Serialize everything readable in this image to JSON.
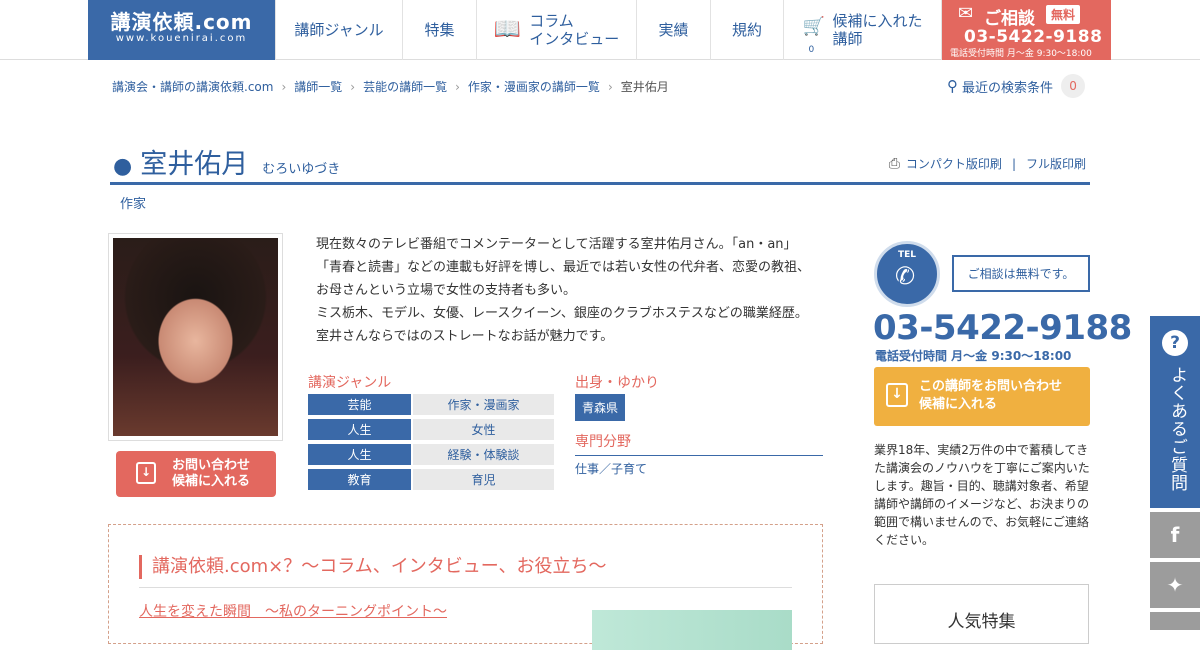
{
  "header": {
    "logo_main": "講演依頼.com",
    "logo_sub": "www.kouenirai.com",
    "nav": [
      {
        "label": "講師ジャンル"
      },
      {
        "label": "特集"
      },
      {
        "label": "コラム\nインタビュー"
      },
      {
        "label": "実績"
      },
      {
        "label": "規約"
      },
      {
        "label": "候補に入れた\n講師",
        "count": "0"
      }
    ],
    "cta_title": "ご相談",
    "cta_free": "無料",
    "cta_phone": "03-5422-9188",
    "cta_hours": "電話受付時間 月〜金 9:30〜18:00"
  },
  "breadcrumb": [
    "講演会・講師の講演依頼.com",
    "講師一覧",
    "芸能の講師一覧",
    "作家・漫画家の講師一覧",
    "室井佑月"
  ],
  "recent_search": {
    "label": "最近の検索条件",
    "count": "0"
  },
  "profile": {
    "name": "室井佑月",
    "kana": "むろいゆづき",
    "occupation": "作家",
    "print_compact": "コンパクト版印刷",
    "print_full": "フル版印刷",
    "description": [
      "現在数々のテレビ番組でコメンテーターとして活躍する室井佑月さん。「an・an」",
      "「青春と読書」などの連載も好評を博し、最近では若い女性の代弁者、恋愛の教祖、",
      "お母さんという立場で女性の支持者も多い。",
      "ミス栃木、モデル、女優、レースクイーン、銀座のクラブホステスなどの職業経歴。",
      "室井さんならではのストレートなお話が魅力です。"
    ],
    "inquiry_button": "お問い合わせ\n候補に入れる",
    "genre_heading": "講演ジャンル",
    "genres": [
      {
        "main": "芸能",
        "sub": "作家・漫画家"
      },
      {
        "main": "人生",
        "sub": "女性"
      },
      {
        "main": "人生",
        "sub": "経験・体験談"
      },
      {
        "main": "教育",
        "sub": "育児"
      }
    ],
    "origin_heading": "出身・ゆかり",
    "origin": "青森県",
    "specialty_heading": "専門分野",
    "specialty": "仕事／子育て"
  },
  "column": {
    "title": "講演依頼.com×？～コラム、インタビュー、お役立ち～",
    "link": "人生を変えた瞬間　～私のターニングポイント～"
  },
  "sidebar": {
    "tel_label": "TEL",
    "bubble": "ご相談は無料です。",
    "phone": "03-5422-9188",
    "hours": "電話受付時間 月〜金 9:30〜18:00",
    "cta": "この講師をお問い合わせ\n候補に入れる",
    "text": "業界18年、実績2万件の中で蓄積してきた講演会のノウハウを丁寧にご案内いたします。趣旨・目的、聴講対象者、希望講師や講師のイメージなど、お決まりの範囲で構いませんので、お気軽にご連絡ください。",
    "popular": "人気特集"
  },
  "side_tabs": {
    "faq": "よくあるご質問"
  },
  "colors": {
    "primary": "#3a69a8",
    "accent": "#e3685f",
    "orange": "#f0b040"
  }
}
